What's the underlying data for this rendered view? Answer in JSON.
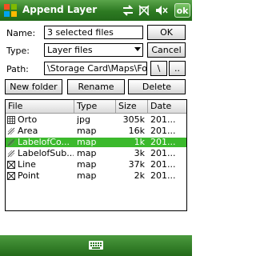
{
  "window": {
    "title": "Append Layer",
    "ok_label": "ok"
  },
  "form": {
    "name_label": "Name:",
    "name_value": "3 selected files",
    "ok_button": "OK",
    "type_label": "Type:",
    "type_value": "Layer files",
    "cancel_button": "Cancel",
    "path_label": "Path:",
    "path_value": "\\Storage Card\\Maps\\For",
    "root_button": "\\",
    "up_button": ".."
  },
  "actions": {
    "new_folder": "New folder",
    "rename": "Rename",
    "delete": "Delete"
  },
  "files": {
    "columns": [
      "File",
      "Type",
      "Size",
      "Date"
    ],
    "rows": [
      {
        "name": "Orto",
        "type": "jpg",
        "size": "305k",
        "date": "201...",
        "icon": "raster-grid-icon",
        "selected": false
      },
      {
        "name": "Area",
        "type": "map",
        "size": "16k",
        "date": "201...",
        "icon": "map-layer-icon",
        "selected": false
      },
      {
        "name": "LabelofCo...",
        "type": "map",
        "size": "1k",
        "date": "201...",
        "icon": "map-layer-icon",
        "selected": true
      },
      {
        "name": "LabelofSub...",
        "type": "map",
        "size": "3k",
        "date": "201...",
        "icon": "map-layer-icon",
        "selected": false
      },
      {
        "name": "Line",
        "type": "map",
        "size": "37k",
        "date": "201...",
        "icon": "vector-layer-icon",
        "selected": false
      },
      {
        "name": "Point",
        "type": "map",
        "size": "2k",
        "date": "201...",
        "icon": "vector-layer-icon",
        "selected": false
      }
    ]
  },
  "colors": {
    "title_bar": "#2d7a22",
    "selection": "#3bb92c"
  }
}
